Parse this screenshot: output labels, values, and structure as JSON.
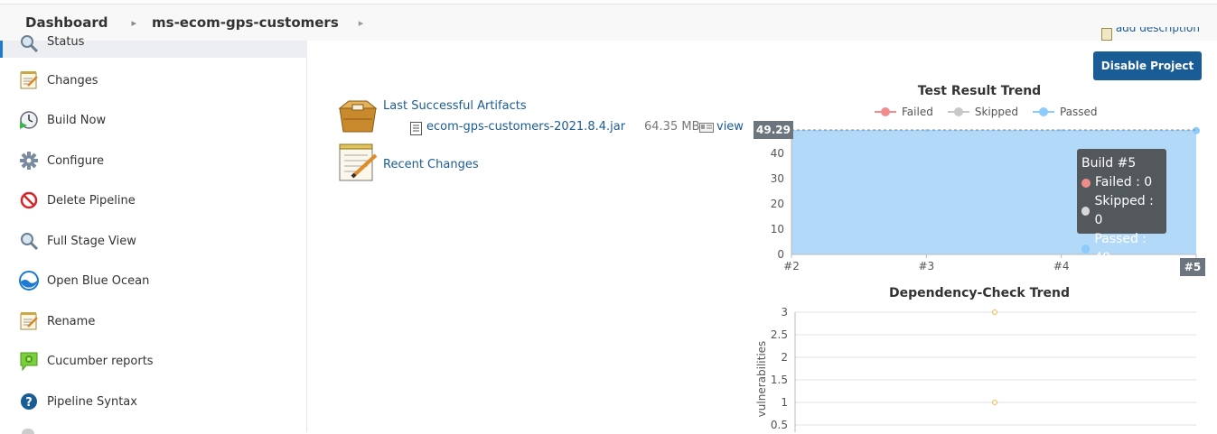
{
  "breadcrumb": {
    "dashboard": "Dashboard",
    "project": "ms-ecom-gps-customers"
  },
  "sidebar": {
    "status": "Status",
    "items": [
      {
        "label": "Changes",
        "icon": "notepad-icon"
      },
      {
        "label": "Build Now",
        "icon": "clock-play-icon"
      },
      {
        "label": "Configure",
        "icon": "gear-icon"
      },
      {
        "label": "Delete Pipeline",
        "icon": "no-entry-icon"
      },
      {
        "label": "Full Stage View",
        "icon": "magnifier-icon"
      },
      {
        "label": "Open Blue Ocean",
        "icon": "blue-ocean-icon"
      },
      {
        "label": "Rename",
        "icon": "notepad-icon"
      },
      {
        "label": "Cucumber reports",
        "icon": "cucumber-icon"
      },
      {
        "label": "Pipeline Syntax",
        "icon": "help-icon"
      }
    ]
  },
  "main": {
    "add_description": "add description",
    "disable_button": "Disable Project",
    "artifacts_label": "Last Successful Artifacts",
    "artifact_file": "ecom-gps-customers-2021.8.4.jar",
    "artifact_size": "64.35 MB",
    "view_label": "view",
    "recent_changes": "Recent Changes"
  },
  "colors": {
    "accent": "#1a5c95",
    "failed": "#ef8c8c",
    "skipped": "#c8c8c8",
    "passed": "#8ccbfa",
    "passed_fill": "#b3d9f8",
    "dep_line": "#f5b942"
  },
  "chart_data": [
    {
      "type": "area",
      "title": "Test Result Trend",
      "categories": [
        "#2",
        "#3",
        "#4",
        "#5"
      ],
      "series": [
        {
          "name": "Failed",
          "values": [
            0,
            0,
            0,
            0
          ]
        },
        {
          "name": "Skipped",
          "values": [
            0,
            0,
            0,
            0
          ]
        },
        {
          "name": "Passed",
          "values": [
            49,
            49,
            49,
            49
          ]
        }
      ],
      "yticks": [
        0,
        10,
        20,
        30,
        40
      ],
      "ylim": [
        0,
        49.29
      ],
      "crosshair_value": "49.29",
      "crosshair_category": "#5",
      "tooltip": {
        "title": "Build #5",
        "failed": "Failed : 0",
        "skipped": "Skipped : 0",
        "passed": "Passed : 49"
      },
      "legend": "top"
    },
    {
      "type": "line",
      "title": "Dependency-Check Trend",
      "ylabel": "vulnerabilities",
      "yticks": [
        "0.5",
        "1",
        "1.5",
        "2",
        "2.5",
        "3"
      ],
      "ylim": [
        0.5,
        3
      ],
      "points": [
        3,
        1
      ]
    }
  ]
}
